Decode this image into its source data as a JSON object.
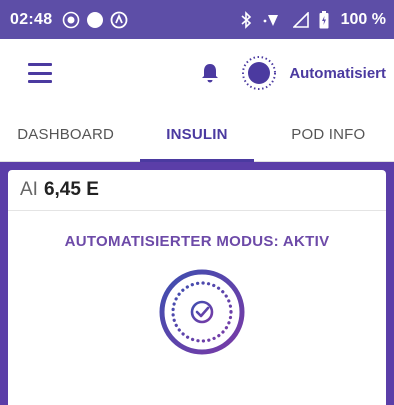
{
  "status_bar": {
    "time": "02:48",
    "battery": "100 %"
  },
  "app_bar": {
    "mode_label": "Automatisiert"
  },
  "tabs": [
    {
      "label": "DASHBOARD",
      "active": false
    },
    {
      "label": "INSULIN",
      "active": true
    },
    {
      "label": "POD INFO",
      "active": false
    }
  ],
  "insulin_card": {
    "iob_label": "AI",
    "iob_value": "6,45 E",
    "mode_status": "AUTOMATISIERTER MODUS: AKTIV"
  },
  "colors": {
    "accent": "#4b3aa0",
    "status_bar": "#5d4ea7",
    "frame": "#5b3ea8",
    "mode_text": "#6d4aa8"
  },
  "icons": [
    "menu-icon",
    "bell-icon",
    "automated-mode-icon",
    "automated-mode-check-icon",
    "bluetooth-icon",
    "wifi-icon",
    "signal-icon",
    "battery-icon"
  ]
}
